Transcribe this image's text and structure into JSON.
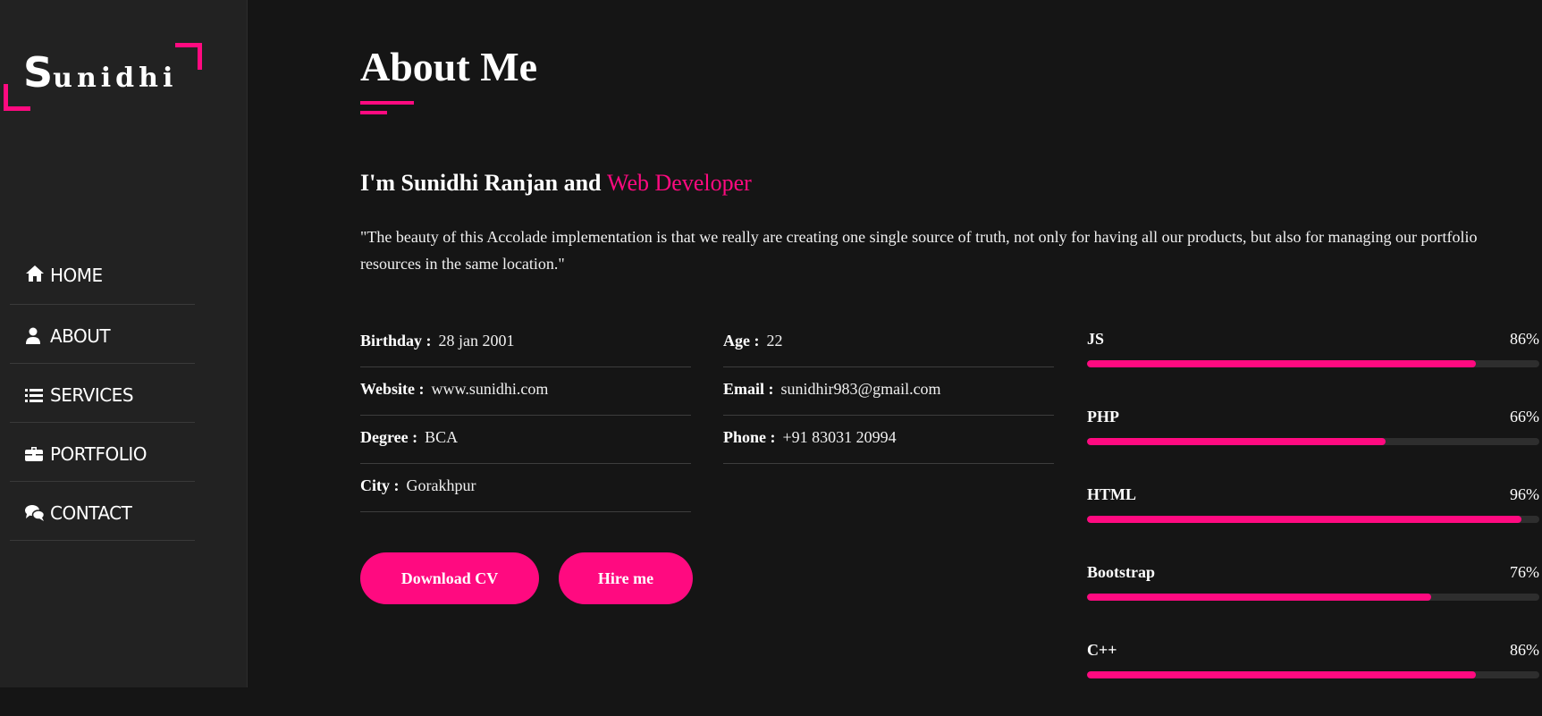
{
  "logo": {
    "initial": "S",
    "rest": "unidhi"
  },
  "nav": [
    {
      "label": "HOME",
      "icon": "home-icon"
    },
    {
      "label": "ABOUT",
      "icon": "user-icon"
    },
    {
      "label": "SERVICES",
      "icon": "list-icon"
    },
    {
      "label": "PORTFOLIO",
      "icon": "briefcase-icon"
    },
    {
      "label": "CONTACT",
      "icon": "comments-icon"
    }
  ],
  "page": {
    "title": "About Me",
    "intro_prefix": "I'm Sunidhi Ranjan and ",
    "intro_accent": "Web Developer",
    "quote": "\"The beauty of this Accolade implementation is that we really are creating one single source of truth, not only for having all our products, but also for managing our portfolio resources in the same location.\""
  },
  "info_left": [
    {
      "label": "Birthday :",
      "value": "28 jan 2001"
    },
    {
      "label": "Website :",
      "value": "www.sunidhi.com"
    },
    {
      "label": "Degree :",
      "value": "BCA"
    },
    {
      "label": "City :",
      "value": "Gorakhpur"
    }
  ],
  "info_right": [
    {
      "label": "Age :",
      "value": "22"
    },
    {
      "label": "Email :",
      "value": "sunidhir983@gmail.com"
    },
    {
      "label": "Phone :",
      "value": "+91 83031 20994"
    }
  ],
  "buttons": {
    "download": "Download CV",
    "hire": "Hire me"
  },
  "skills": [
    {
      "name": "JS",
      "percent_label": "86%",
      "level": 86
    },
    {
      "name": "PHP",
      "percent_label": "66%",
      "level": 66
    },
    {
      "name": "HTML",
      "percent_label": "96%",
      "level": 96
    },
    {
      "name": "Bootstrap",
      "percent_label": "76%",
      "level": 76
    },
    {
      "name": "C++",
      "percent_label": "86%",
      "level": 86
    }
  ],
  "colors": {
    "accent": "#ff0a80",
    "background": "#151515",
    "sidebar": "#222222"
  }
}
